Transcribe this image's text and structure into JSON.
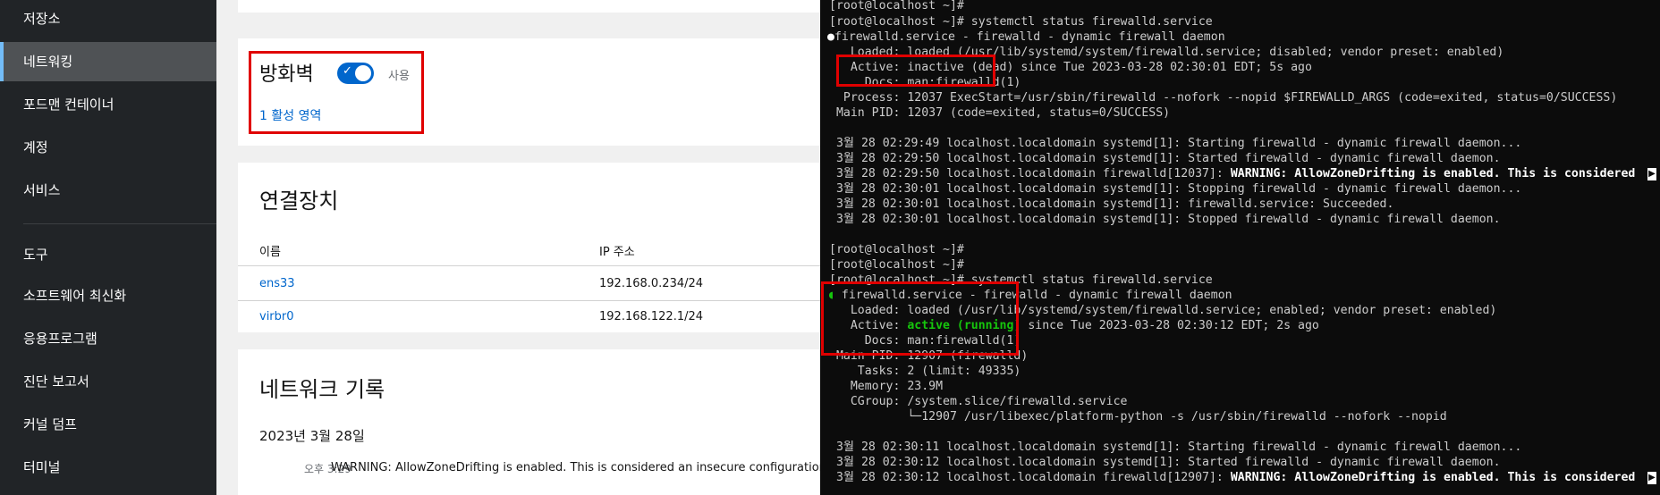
{
  "sidebar": {
    "items": [
      {
        "label": "저장소"
      },
      {
        "label": "네트워킹"
      },
      {
        "label": "포드맨 컨테이너"
      },
      {
        "label": "계정"
      },
      {
        "label": "서비스"
      }
    ],
    "tools_heading": "도구",
    "tools": [
      {
        "label": "소프트웨어 최신화"
      },
      {
        "label": "응용프로그램"
      },
      {
        "label": "진단 보고서"
      },
      {
        "label": "커널 덤프"
      },
      {
        "label": "터미널"
      }
    ]
  },
  "firewall": {
    "title": "방화벽",
    "switch_state": "사용",
    "switch_check": "✓",
    "zones_link": "1 활성 영역"
  },
  "devices": {
    "title": "연결장치",
    "columns": [
      "이름",
      "IP 주소"
    ],
    "rows": [
      {
        "name": "ens33",
        "ip": "192.168.0.234/24"
      },
      {
        "name": "virbr0",
        "ip": "192.168.122.1/24"
      }
    ]
  },
  "network_log": {
    "title": "네트워크 기록",
    "date": "2023년 3월 28일",
    "entries": [
      {
        "time": "오후 3:29",
        "message": "WARNING: AllowZoneDrifting is enabled. This is considered an insecure configuration op"
      }
    ]
  },
  "terminal": {
    "lines": [
      "[root@localhost ~]#",
      "[root@localhost ~]# systemctl status firewalld.service",
      "firewalld.service - firewalld - dynamic firewall daemon",
      "   Loaded: loaded (/usr/lib/systemd/system/firewalld.service; disabled; vendor preset: enabled)",
      "   Active: inactive (dead) since Tue 2023-03-28 02:30:01 EDT; 5s ago",
      "     Docs: man:firewalld(1)",
      "  Process: 12037 ExecStart=/usr/sbin/firewalld --nofork --nopid $FIREWALLD_ARGS (code=exited, status=0/SUCCESS)",
      " Main PID: 12037 (code=exited, status=0/SUCCESS)",
      "",
      " 3월 28 02:29:49 localhost.localdomain systemd[1]: Starting firewalld - dynamic firewall daemon...",
      " 3월 28 02:29:50 localhost.localdomain systemd[1]: Started firewalld - dynamic firewall daemon.",
      " 3월 28 02:29:50 localhost.localdomain firewalld[12037]: ",
      " 3월 28 02:30:01 localhost.localdomain systemd[1]: Stopping firewalld - dynamic firewall daemon...",
      " 3월 28 02:30:01 localhost.localdomain systemd[1]: firewalld.service: Succeeded.",
      " 3월 28 02:30:01 localhost.localdomain systemd[1]: Stopped firewalld - dynamic firewall daemon.",
      "",
      "[root@localhost ~]#",
      "[root@localhost ~]#",
      "[root@localhost ~]# systemctl status firewalld.service",
      " firewalld.service - firewalld - dynamic firewall daemon",
      "   Loaded: loaded (/usr/lib/systemd/system/firewalld.service; enabled; vendor preset: enabled)",
      "   Active: ",
      "     Docs: man:firewalld(1)",
      " Main PID: 12907 (firewalld)",
      "    Tasks: 2 (limit: 49335)",
      "   Memory: 23.9M",
      "   CGroup: /system.slice/firewalld.service",
      "           └─12907 /usr/libexec/platform-python -s /usr/sbin/firewalld --nofork --nopid",
      "",
      " 3월 28 02:30:11 localhost.localdomain systemd[1]: Starting firewalld - dynamic firewall daemon...",
      " 3월 28 02:30:12 localhost.localdomain systemd[1]: Started firewalld - dynamic firewall daemon.",
      " 3월 28 02:30:12 localhost.localdomain firewalld[12907]: "
    ],
    "warning_text": "WARNING: AllowZoneDrifting is enabled. This is considered",
    "active_running": "active (running)",
    "active_running_rest": " since Tue 2023-03-28 02:30:12 EDT; 2s ago",
    "status_dot": "●",
    "running_dot": "◖",
    "scroll_glyph": "▶"
  },
  "colors": {
    "sidebar_bg": "#212427",
    "accent_blue": "#0066cc",
    "highlight_red": "#e00000",
    "terminal_green": "#16c60c"
  }
}
